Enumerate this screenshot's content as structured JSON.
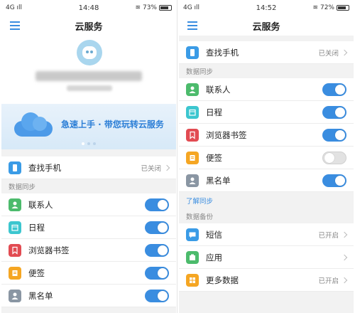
{
  "colors": {
    "accent": "#3a8de0",
    "background": "#f2f2f2"
  },
  "left": {
    "status": {
      "network": "4G ıll",
      "time": "14:48",
      "battery": "73%"
    },
    "title": "云服务",
    "banner_text": "急速上手 · 带您玩转云服务",
    "find_phone": {
      "label": "查找手机",
      "value": "已关闭"
    },
    "sync_section": "数据同步",
    "sync_items": [
      {
        "label": "联系人",
        "icon": "contacts-icon",
        "on": true
      },
      {
        "label": "日程",
        "icon": "calendar-icon",
        "on": true
      },
      {
        "label": "浏览器书签",
        "icon": "bookmark-icon",
        "on": true
      },
      {
        "label": "便签",
        "icon": "notes-icon",
        "on": true
      },
      {
        "label": "黑名单",
        "icon": "blacklist-icon",
        "on": true
      }
    ]
  },
  "right": {
    "status": {
      "network": "4G ıll",
      "time": "14:52",
      "battery": "72%"
    },
    "title": "云服务",
    "find_phone": {
      "label": "查找手机",
      "value": "已关闭"
    },
    "sync_section": "数据同步",
    "sync_items": [
      {
        "label": "联系人",
        "icon": "contacts-icon",
        "on": true
      },
      {
        "label": "日程",
        "icon": "calendar-icon",
        "on": true
      },
      {
        "label": "浏览器书签",
        "icon": "bookmark-icon",
        "on": true
      },
      {
        "label": "便签",
        "icon": "notes-icon",
        "on": false
      },
      {
        "label": "黑名单",
        "icon": "blacklist-icon",
        "on": true
      }
    ],
    "learn_sync": "了解同步",
    "backup_section": "数据备份",
    "backup_items": [
      {
        "label": "短信",
        "value": "已开启",
        "icon": "sms-icon"
      },
      {
        "label": "应用",
        "value": "",
        "icon": "apps-icon"
      },
      {
        "label": "更多数据",
        "value": "已开启",
        "icon": "more-data-icon"
      }
    ]
  }
}
